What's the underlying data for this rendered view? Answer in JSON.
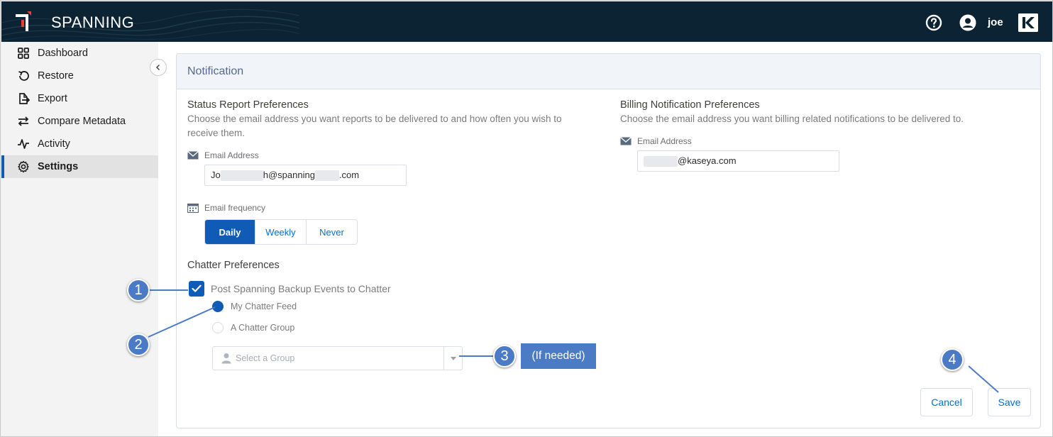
{
  "app": {
    "brand": "SPANNING",
    "user_name": "joe"
  },
  "sidebar": {
    "items": [
      {
        "label": "Dashboard",
        "icon": "grid-icon"
      },
      {
        "label": "Restore",
        "icon": "restore-icon"
      },
      {
        "label": "Export",
        "icon": "export-icon"
      },
      {
        "label": "Compare Metadata",
        "icon": "compare-icon"
      },
      {
        "label": "Activity",
        "icon": "activity-icon"
      },
      {
        "label": "Settings",
        "icon": "gear-icon",
        "active": true
      }
    ]
  },
  "card": {
    "title": "Notification"
  },
  "status_report": {
    "title": "Status Report Preferences",
    "description": "Choose the email address you want reports to be delivered to and how often you wish to receive them.",
    "email_label": "Email Address",
    "email_parts": {
      "a": "Jo",
      "b": "h@spanning",
      "c": ".com"
    },
    "frequency_label": "Email frequency",
    "frequency_options": [
      "Daily",
      "Weekly",
      "Never"
    ],
    "frequency_selected": "Daily"
  },
  "billing": {
    "title": "Billing Notification Preferences",
    "description": "Choose the email address you want billing related notifications to be delivered to.",
    "email_label": "Email Address",
    "email_suffix": "@kaseya.com"
  },
  "chatter": {
    "title": "Chatter Preferences",
    "checkbox_label": "Post Spanning Backup Events to Chatter",
    "checkbox_checked": true,
    "radio_options": [
      "My Chatter Feed",
      "A Chatter Group"
    ],
    "radio_selected": "My Chatter Feed",
    "group_placeholder": "Select a Group"
  },
  "actions": {
    "cancel": "Cancel",
    "save": "Save"
  },
  "annotations": {
    "callouts": [
      "1",
      "2",
      "3",
      "4"
    ],
    "note": "(If needed)"
  },
  "colors": {
    "topbar": "#0b2332",
    "primary": "#0f5bb5",
    "link": "#0070d2",
    "callout": "#4a7bc4",
    "logo_red": "#e8412c"
  }
}
